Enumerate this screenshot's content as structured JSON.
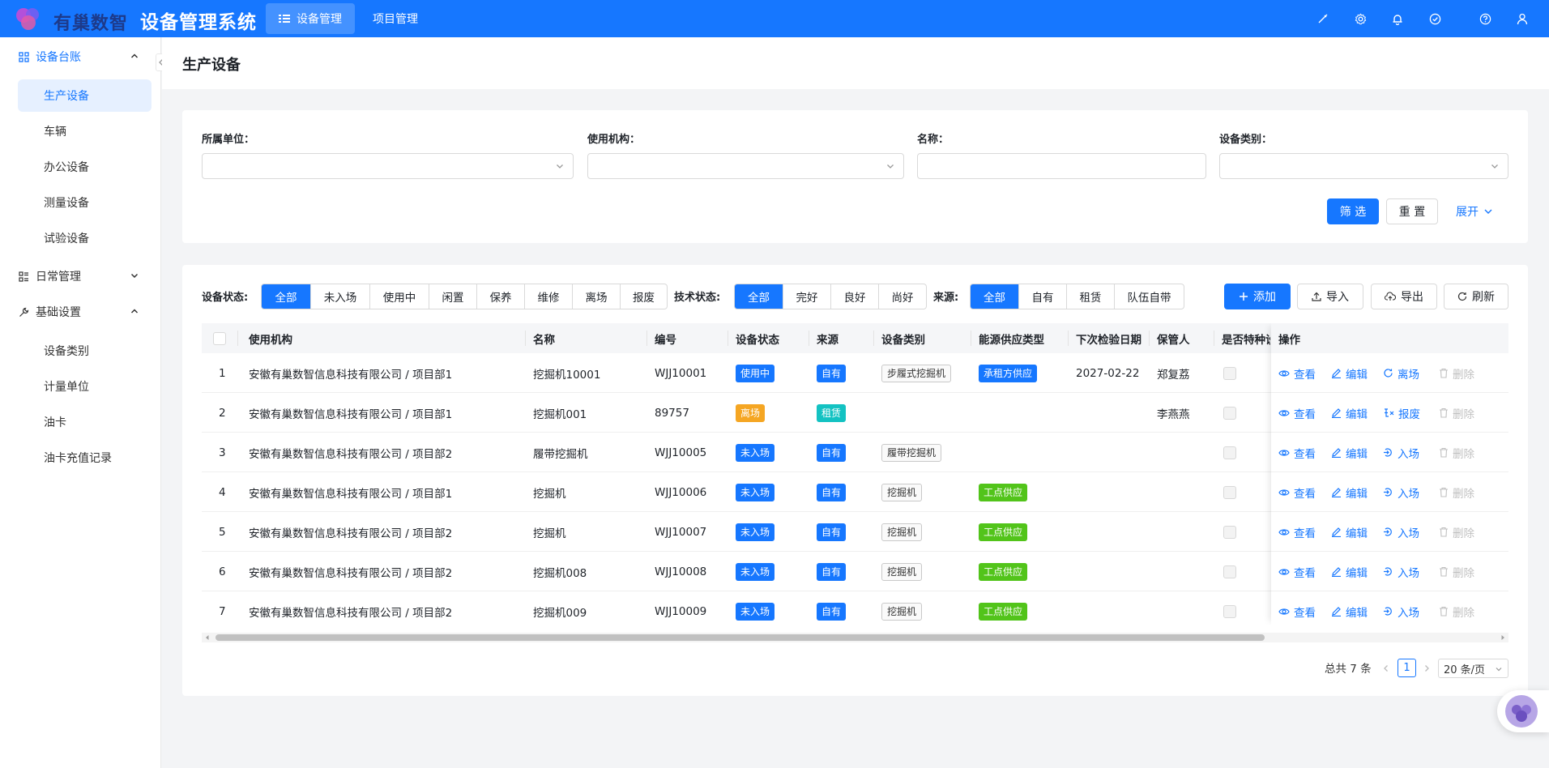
{
  "app": {
    "brand": "有巢数智",
    "title": "设备管理系统"
  },
  "topnav": [
    {
      "label": "设备管理",
      "icon": "list-icon",
      "active": true
    },
    {
      "label": "项目管理",
      "active": false
    }
  ],
  "top_icons": [
    "brush-icon",
    "settings-icon",
    "bell-icon",
    "check-circle-icon",
    "help-icon",
    "user-icon"
  ],
  "sidebar": {
    "groups": [
      {
        "label": "设备台账",
        "icon": "grid-icon",
        "expanded": true,
        "items": [
          "生产设备",
          "车辆",
          "办公设备",
          "测量设备",
          "试验设备"
        ]
      },
      {
        "label": "日常管理",
        "icon": "form-icon",
        "expanded": false,
        "items": []
      },
      {
        "label": "基础设置",
        "icon": "wrench-icon",
        "expanded": true,
        "items": [
          "设备类别",
          "计量单位",
          "油卡",
          "油卡充值记录"
        ]
      }
    ],
    "active_item": "生产设备"
  },
  "page": {
    "title": "生产设备"
  },
  "filters": {
    "unit_label": "所属单位：",
    "org_label": "使用机构：",
    "name_label": "名称：",
    "category_label": "设备类别：",
    "filter_btn": "筛 选",
    "reset_btn": "重 置",
    "expand_link": "展开"
  },
  "toolbar": {
    "status_label": "设备状态:",
    "status_options": [
      "全部",
      "未入场",
      "使用中",
      "闲置",
      "保养",
      "维修",
      "离场",
      "报废"
    ],
    "tech_label": "技术状态:",
    "tech_options": [
      "全部",
      "完好",
      "良好",
      "尚好"
    ],
    "source_label": "来源:",
    "source_options": [
      "全部",
      "自有",
      "租赁",
      "队伍自带"
    ],
    "add_btn": "添加",
    "import_btn": "导入",
    "export_btn": "导出",
    "refresh_btn": "刷新"
  },
  "table": {
    "columns": [
      "使用机构",
      "名称",
      "编号",
      "设备状态",
      "来源",
      "设备类别",
      "能源供应类型",
      "下次检验日期",
      "保管人",
      "是否特种设备",
      "操作"
    ],
    "rows": [
      {
        "idx": "1",
        "org": "安徽有巢数智信息科技有限公司 / 项目部1",
        "name": "挖掘机10001",
        "code": "WJJ10001",
        "status": "使用中",
        "status_color": "blue",
        "source": "自有",
        "source_color": "blue",
        "category": "步履式挖掘机",
        "energy": "承租方供应",
        "energy_color": "blue",
        "next_check": "2027-02-22",
        "keeper": "郑复荔",
        "actions": [
          "查看",
          "编辑",
          "离场",
          "删除"
        ]
      },
      {
        "idx": "2",
        "org": "安徽有巢数智信息科技有限公司 / 项目部1",
        "name": "挖掘机001",
        "code": "89757",
        "status": "离场",
        "status_color": "orange",
        "source": "租赁",
        "source_color": "teal",
        "category": "",
        "energy": "",
        "next_check": "",
        "keeper": "李燕燕",
        "actions": [
          "查看",
          "编辑",
          "报废",
          "删除"
        ]
      },
      {
        "idx": "3",
        "org": "安徽有巢数智信息科技有限公司 / 项目部2",
        "name": "履带挖掘机",
        "code": "WJJ10005",
        "status": "未入场",
        "status_color": "blue",
        "source": "自有",
        "source_color": "blue",
        "category": "履带挖掘机",
        "energy": "",
        "next_check": "",
        "keeper": "",
        "actions": [
          "查看",
          "编辑",
          "入场",
          "删除"
        ]
      },
      {
        "idx": "4",
        "org": "安徽有巢数智信息科技有限公司 / 项目部1",
        "name": "挖掘机",
        "code": "WJJ10006",
        "status": "未入场",
        "status_color": "blue",
        "source": "自有",
        "source_color": "blue",
        "category": "挖掘机",
        "energy": "工点供应",
        "energy_color": "green",
        "next_check": "",
        "keeper": "",
        "actions": [
          "查看",
          "编辑",
          "入场",
          "删除"
        ]
      },
      {
        "idx": "5",
        "org": "安徽有巢数智信息科技有限公司 / 项目部2",
        "name": "挖掘机",
        "code": "WJJ10007",
        "status": "未入场",
        "status_color": "blue",
        "source": "自有",
        "source_color": "blue",
        "category": "挖掘机",
        "energy": "工点供应",
        "energy_color": "green",
        "next_check": "",
        "keeper": "",
        "actions": [
          "查看",
          "编辑",
          "入场",
          "删除"
        ]
      },
      {
        "idx": "6",
        "org": "安徽有巢数智信息科技有限公司 / 项目部2",
        "name": "挖掘机008",
        "code": "WJJ10008",
        "status": "未入场",
        "status_color": "blue",
        "source": "自有",
        "source_color": "blue",
        "category": "挖掘机",
        "energy": "工点供应",
        "energy_color": "green",
        "next_check": "",
        "keeper": "",
        "actions": [
          "查看",
          "编辑",
          "入场",
          "删除"
        ]
      },
      {
        "idx": "7",
        "org": "安徽有巢数智信息科技有限公司 / 项目部2",
        "name": "挖掘机009",
        "code": "WJJ10009",
        "status": "未入场",
        "status_color": "blue",
        "source": "自有",
        "source_color": "blue",
        "category": "挖掘机",
        "energy": "工点供应",
        "energy_color": "green",
        "next_check": "",
        "keeper": "",
        "actions": [
          "查看",
          "编辑",
          "入场",
          "删除"
        ]
      }
    ]
  },
  "pagination": {
    "total_text": "总共 7 条",
    "current_page": "1",
    "page_size": "20 条/页"
  },
  "colors": {
    "primary": "#1677ff",
    "orange": "#f5a623",
    "teal": "#13c2c2",
    "green": "#52c41a"
  }
}
